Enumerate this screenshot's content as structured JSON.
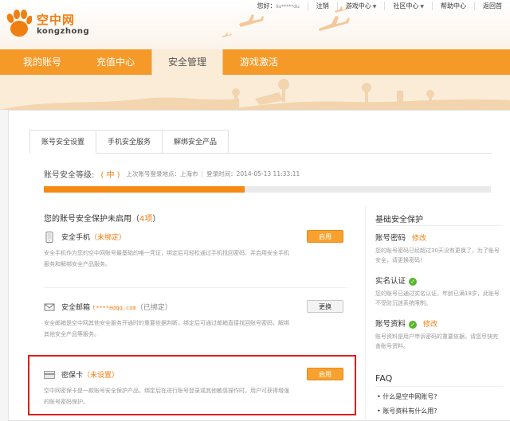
{
  "brand": {
    "name_cn": "空中网",
    "name_en": "kongzhong",
    "color": "#f07f12"
  },
  "topnav": {
    "greeting": "您好：",
    "username": "ks*****du",
    "logout": "注销",
    "game_center": "游戏中心",
    "community_center": "社区中心",
    "help_center": "帮助中心",
    "back_home": "返回首"
  },
  "mainnav": {
    "tabs": [
      {
        "label": "我的账号"
      },
      {
        "label": "充值中心"
      },
      {
        "label": "安全管理",
        "active": true
      },
      {
        "label": "游戏激活"
      }
    ]
  },
  "subtabs": [
    {
      "label": "账号安全设置",
      "active": true
    },
    {
      "label": "手机安全服务"
    },
    {
      "label": "解绑安全产品"
    }
  ],
  "security": {
    "level_label": "账号安全等级:",
    "level_value": "( 中 )",
    "last_login_place": "上次账号登录地点：上海市",
    "sep": "|",
    "login_time": "登录时间：2014-05-13 11:33:11",
    "progress": 0.45
  },
  "protect": {
    "title_prefix": "您的账号安全保护未启用（",
    "count": "4项",
    "title_suffix": "）",
    "items": [
      {
        "icon": "phone-icon",
        "name": "安全手机",
        "status": "（未绑定）",
        "desc": "安全手机作为您的空中网账号最基础的唯一凭证，绑定后可轻松通过手机找回密码、并启用安全手机服务和解绑安全产品服务。",
        "button": "启用"
      },
      {
        "icon": "mail-icon",
        "name": "安全邮箱",
        "email": "t****e@qq.com",
        "status": "（已绑定）",
        "desc": "安全邮箱是空中网其他安全服务开通时的重要依据判断，绑定后可通过邮箱直接找回账号密码、解绑其他安全产品等服务。",
        "button": "更换"
      },
      {
        "icon": "card-icon",
        "name": "密保卡",
        "status": "（未设置）",
        "desc": "空中网密保卡是一款账号安全保护产品，绑定后在进行账号登录或其他敏感操作时，用户可获得增强的账号密码保护。",
        "button": "启用"
      }
    ]
  },
  "sidebar": {
    "title": "基础安全保护",
    "items": [
      {
        "title": "账号密码",
        "link": "修改",
        "desc": "您的账号密码已经超过30天没有更换了，为了账号安全，请更换密码！"
      },
      {
        "title": "实名认证",
        "check": "✓",
        "desc": "您的账号已通过实名认证，年龄已满18岁，此账号不受防沉迷系统限制。"
      },
      {
        "title": "账号资料",
        "check": "✓",
        "link": "修改",
        "desc": "账号资料是用户申诉密码的重要依据，请您尽快完善账号资料。"
      }
    ],
    "faq_title": "FAQ",
    "faq": [
      "• 什么是空中网账号?",
      "• 账号资料有什么用?"
    ]
  }
}
